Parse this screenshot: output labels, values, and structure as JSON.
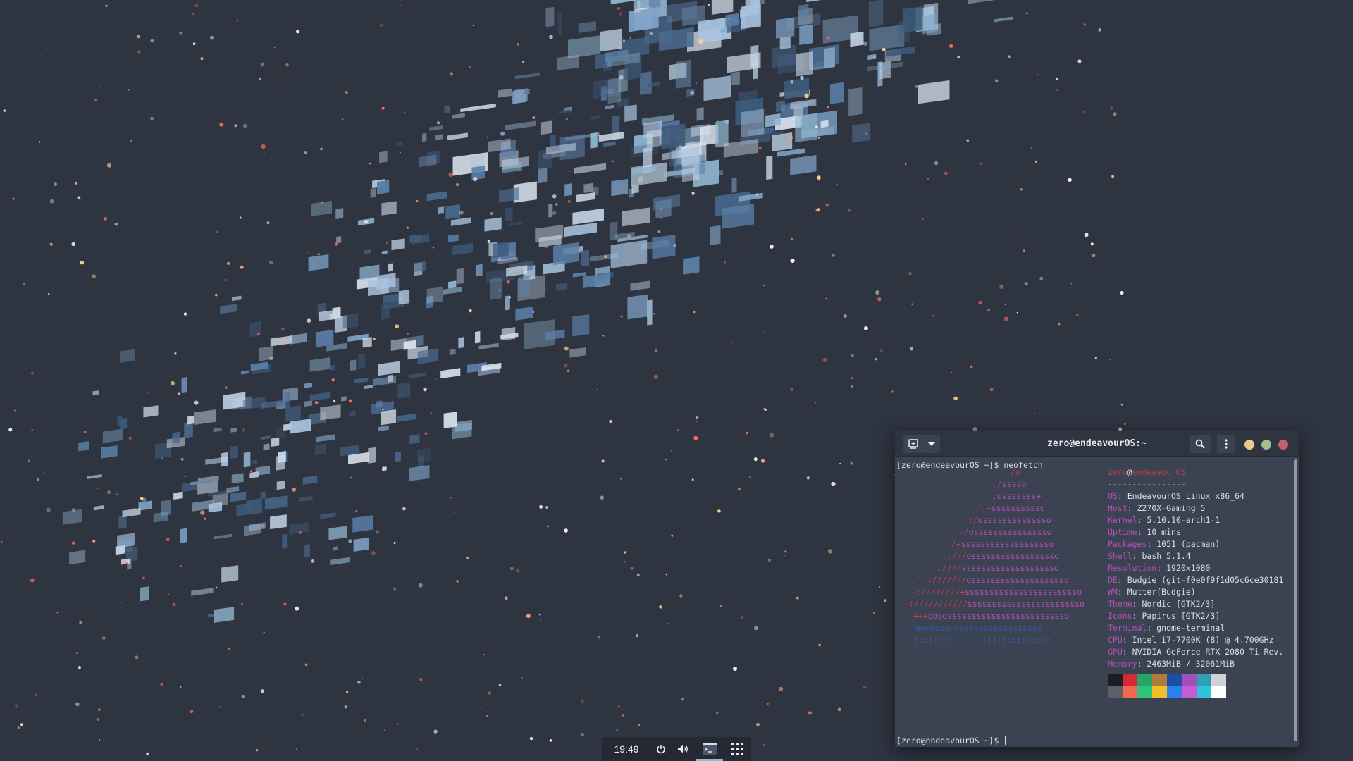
{
  "colors": {
    "desktop_bg": "#2e3440",
    "terminal_bg": "#3b4252",
    "titlebar_bg": "#2e3440",
    "accent_cyan": "#88c0d0",
    "logo_red": "#bf3e4a",
    "logo_magenta": "#b84fb8",
    "logo_blue": "#2d5ea8"
  },
  "terminal": {
    "title": "zero@endeavourOS:~",
    "prompt_command": "[zero@endeavourOS ~]$ neofetch",
    "prompt_final": "[zero@endeavourOS ~]$ ",
    "titlebar_icons": [
      "new-tab-icon",
      "chevron-down-icon",
      "search-icon",
      "kebab-menu-icon"
    ],
    "window_controls": [
      "minimize",
      "maximize",
      "close"
    ],
    "logo_lines": [
      {
        "red": "./o",
        "mag": "",
        "blue": ""
      },
      {
        "red": "./",
        "mag": "sssso",
        "blue": ""
      },
      {
        "red": "`:",
        "mag": "osssssss+",
        "blue": ""
      },
      {
        "red": "`:+",
        "mag": "sssssssssso",
        "blue": ""
      },
      {
        "red": "`:/",
        "mag": "ossssssssssssso",
        "blue": ""
      },
      {
        "red": "`-/",
        "mag": "ossssssssssssssso",
        "blue": ""
      },
      {
        "red": "`-/+",
        "mag": "sssssssssssssssssso",
        "blue": ""
      },
      {
        "red": "`-:///",
        "mag": "ossssssssssssssssso",
        "blue": ""
      },
      {
        "red": "`-:////",
        "mag": "ssssssssssssssssssso",
        "blue": ""
      },
      {
        "red": "`-:///////",
        "mag": "ossssssssssssssssssso",
        "blue": ""
      },
      {
        "red": "`-:////////+",
        "mag": "ssssssssssssssssssssssso",
        "blue": ""
      },
      {
        "red": "`-:///////////",
        "mag": "ssssssssssssssssssssssso",
        "blue": ""
      },
      {
        "red": "`-+++",
        "mag": "oooosssssssssssssssssssssssso",
        "blue": ""
      },
      {
        "red": "",
        "mag": "",
        "blue": "`ooooooooosssssssssssssssss"
      },
      {
        "red": "",
        "mag": "",
        "blue": "`::::::::::::::::::::::::::::"
      }
    ],
    "user": "zero",
    "at": "@",
    "host": "endeavourOS",
    "separator": "----------------",
    "info": [
      {
        "key": "OS",
        "value": "EndeavourOS Linux x86_64"
      },
      {
        "key": "Host",
        "value": "Z270X-Gaming 5"
      },
      {
        "key": "Kernel",
        "value": "5.10.10-arch1-1"
      },
      {
        "key": "Uptime",
        "value": "10 mins"
      },
      {
        "key": "Packages",
        "value": "1051 (pacman)"
      },
      {
        "key": "Shell",
        "value": "bash 5.1.4"
      },
      {
        "key": "Resolution",
        "value": "1920x1080"
      },
      {
        "key": "DE",
        "value": "Budgie (git-f0e0f9f1d05c6ce30181"
      },
      {
        "key": "WM",
        "value": "Mutter(Budgie)"
      },
      {
        "key": "Theme",
        "value": "Nordic [GTK2/3]"
      },
      {
        "key": "Icons",
        "value": "Papirus [GTK2/3]"
      },
      {
        "key": "Terminal",
        "value": "gnome-terminal"
      },
      {
        "key": "CPU",
        "value": "Intel i7-7700K (8) @ 4.700GHz"
      },
      {
        "key": "GPU",
        "value": "NVIDIA GeForce RTX 2080 Ti Rev."
      },
      {
        "key": "Memory",
        "value": "2463MiB / 32061MiB"
      }
    ],
    "palette_row1": [
      "#1b1d27",
      "#d42a35",
      "#29a36a",
      "#b07a3c",
      "#1c4fa3",
      "#a14fbd",
      "#2f9fb5",
      "#cfd2d6"
    ],
    "palette_row2": [
      "#5c5f66",
      "#f2694f",
      "#2fc27a",
      "#f0c028",
      "#2d7ff0",
      "#c75cd4",
      "#30c4dc",
      "#ffffff"
    ]
  },
  "panel": {
    "clock": "19:49",
    "icons": [
      "power-icon",
      "volume-icon",
      "terminal-icon",
      "app-grid-icon"
    ]
  }
}
